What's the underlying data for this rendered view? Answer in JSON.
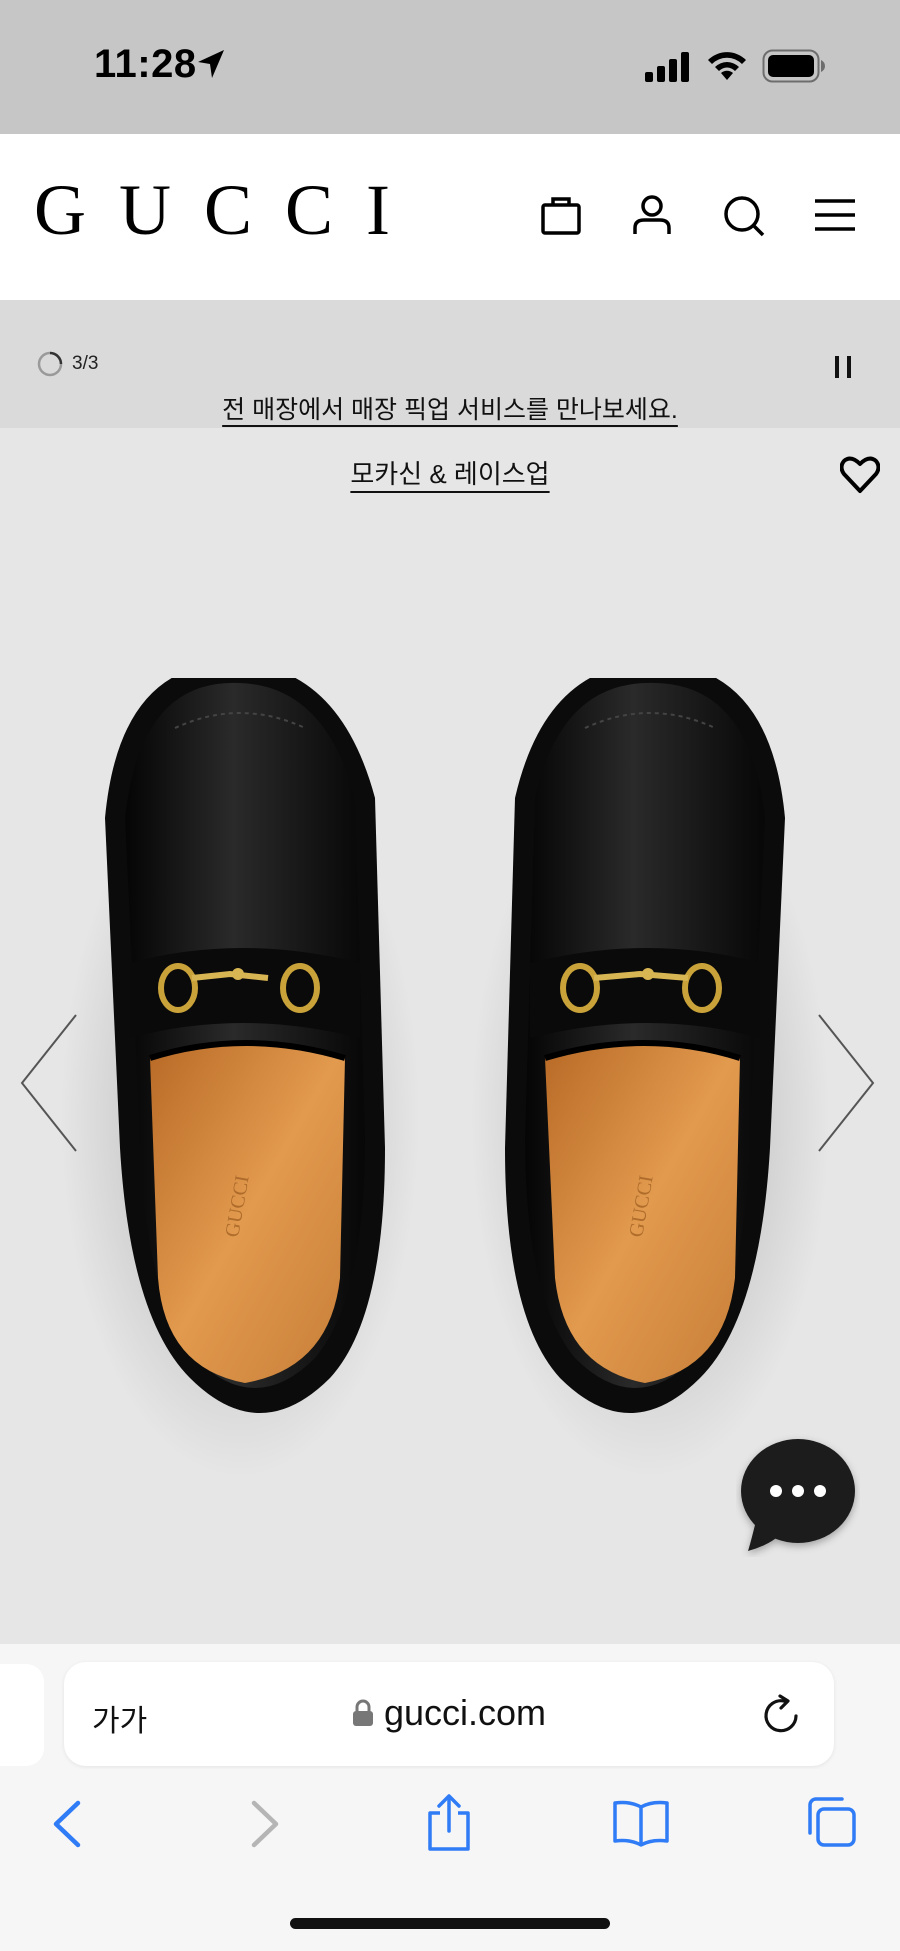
{
  "status_bar": {
    "time": "11:28",
    "icons": [
      "location-arrow-icon",
      "cellular-signal-icon",
      "wifi-icon",
      "battery-icon"
    ]
  },
  "header": {
    "logo_text": "GUCCI",
    "icons": [
      "shopping-bag-icon",
      "account-icon",
      "search-icon",
      "menu-icon"
    ]
  },
  "promo": {
    "counter": "3/3",
    "message": "전 매장에서 매장 픽업 서비스를 만나보세요."
  },
  "product": {
    "category_link": "모카신 & 레이스업",
    "image_description_icon": "loafer-product-image",
    "colors": {
      "background": "#e6e6e6",
      "leather": "#121212",
      "lining": "#d08a3e",
      "hardware": "#c9a23a"
    }
  },
  "browser": {
    "text_size_label": "가가",
    "url": "gucci.com",
    "accent": "#2f7cf6"
  }
}
